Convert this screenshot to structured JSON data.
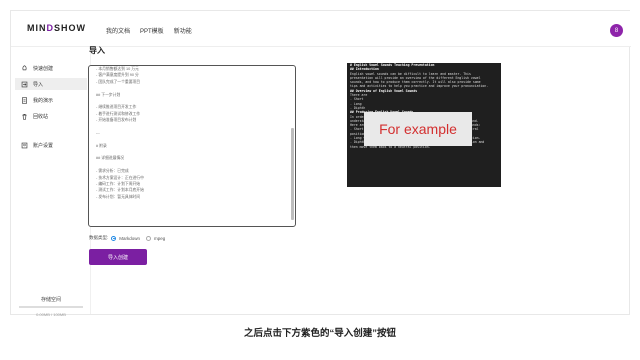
{
  "app": {
    "logo_prefix": "MIN",
    "logo_accent": "D",
    "logo_suffix": "SHOW",
    "accent_color": "#7b1fa2"
  },
  "nav": {
    "items": [
      "我的文档",
      "PPT模板",
      "新功能"
    ]
  },
  "user": {
    "avatar_initial": "8"
  },
  "sidebar": {
    "items": [
      {
        "label": "快速创建",
        "icon": "rocket-icon"
      },
      {
        "label": "导入",
        "icon": "import-icon",
        "active": true
      },
      {
        "label": "我的演示",
        "icon": "doc-icon"
      },
      {
        "label": "回收站",
        "icon": "trash-icon"
      },
      {
        "label": "账户设置",
        "icon": "account-icon"
      }
    ],
    "storage_label": "存储空间",
    "storage_usage": "0.00MB / 100MB",
    "storage_fraction": 0.0
  },
  "main": {
    "title": "导入",
    "editor_lines": [
      "- 本月销售额达到 10 万元",
      "- 客户满意度提升到 90 分",
      "- 团队完成了一个重要项目",
      "",
      "## 下一步计划",
      "",
      "- 继续推进项目开发工作",
      "- 着手进行测试和修改工作",
      "- 开始准备项目发布计划",
      "",
      "---",
      "",
      "# 附录",
      "",
      "## 详细进展情况",
      "",
      "- 需求分析：已完成",
      "- 技术方案设计：正在进行中",
      "- 编码工作：计划下周开始",
      "- 测试工作：计划本月底开始",
      "- 发布计划：暂无具体时间"
    ],
    "format_label": "数据类型:",
    "formats": [
      "Markdown",
      "mpeg"
    ],
    "selected_format": "Markdown",
    "import_button": "导入创建"
  },
  "preview": {
    "lines": [
      {
        "text": "# English Vowel Sounds Teaching Presentation",
        "heading": true
      },
      {
        "text": "",
        "heading": false
      },
      {
        "text": "## Introduction",
        "heading": true
      },
      {
        "text": "",
        "heading": false
      },
      {
        "text": "English vowel sounds can be difficult to learn and master. This",
        "heading": false
      },
      {
        "text": "presentation will provide an overview of the different English vowel",
        "heading": false
      },
      {
        "text": "sounds, and how to produce them correctly. It will also provide some",
        "heading": false
      },
      {
        "text": "tips and activities to help you practice and improve your pronunciation.",
        "heading": false
      },
      {
        "text": "",
        "heading": false
      },
      {
        "text": "## Overview of English Vowel Sounds",
        "heading": true
      },
      {
        "text": "",
        "heading": false
      },
      {
        "text": "There are",
        "heading": false
      },
      {
        "text": "- Short",
        "heading": false
      },
      {
        "text": "- Long",
        "heading": false
      },
      {
        "text": "- Diphth",
        "heading": false
      },
      {
        "text": "",
        "heading": false
      },
      {
        "text": "## Producing English Vowel Sounds",
        "heading": true
      },
      {
        "text": "In order to produce English vowel sounds correctly, you need to",
        "heading": false
      },
      {
        "text": "understand the different mouth and tongue positions for each sound.",
        "heading": false
      },
      {
        "text": "Here are some tips for producing the different English vowel sounds:",
        "heading": false
      },
      {
        "text": "",
        "heading": false
      },
      {
        "text": "- Short vowels: Keep your mouth and tongue relaxed and in a neutral",
        "heading": false
      },
      {
        "text": "position.",
        "heading": false
      },
      {
        "text": "- Long vowels: Move your mouth and tongue into a more open position.",
        "heading": false
      },
      {
        "text": "- Diphthongs: Move your mouth and tongue into a more open position and",
        "heading": false
      },
      {
        "text": "then move them back to a neutral position.",
        "heading": false
      }
    ],
    "overlay_text": "For example"
  },
  "caption": "之后点击下方紫色的“导入创建”按钮"
}
